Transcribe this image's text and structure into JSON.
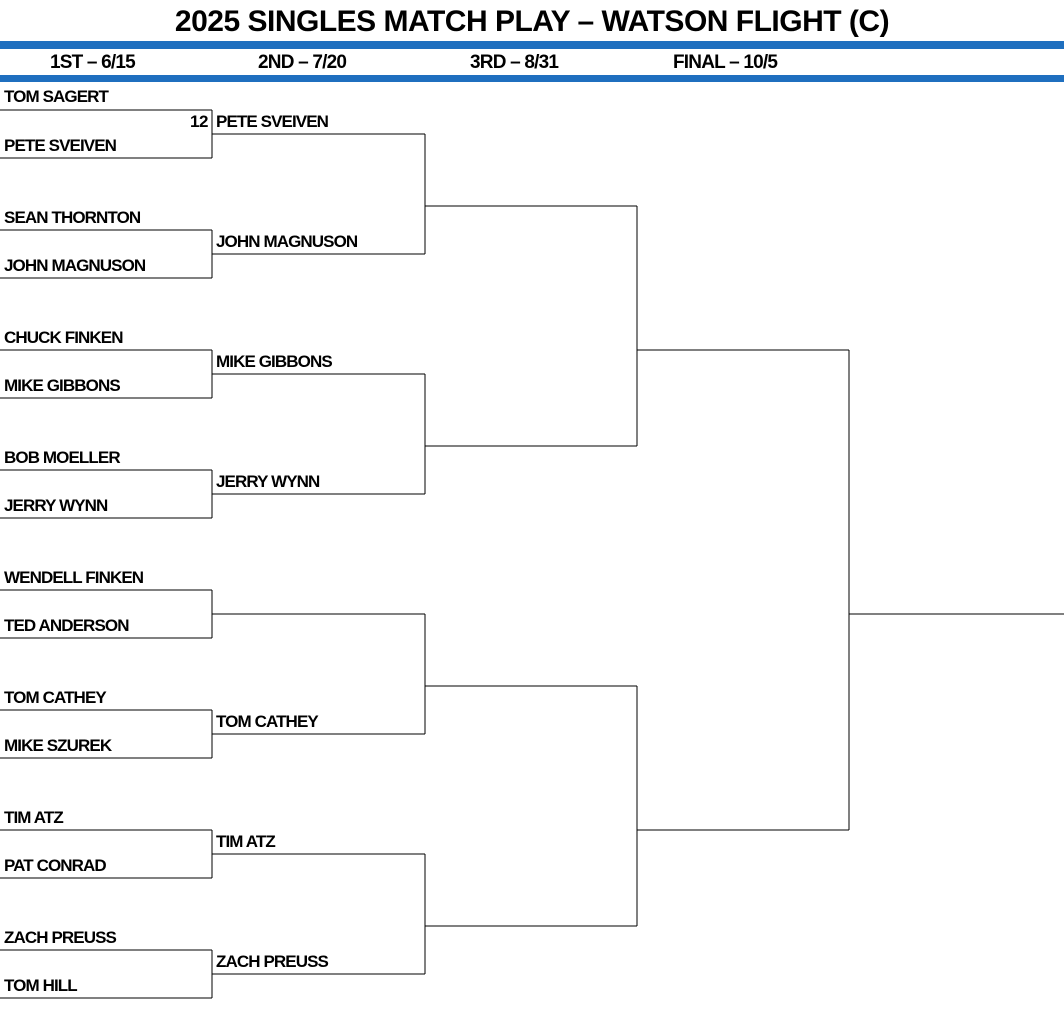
{
  "title": "2025 SINGLES MATCH PLAY – WATSON FLIGHT (C)",
  "colors": {
    "band": "#1f6fbf",
    "line": "#000000"
  },
  "rounds": [
    "1ST – 6/15",
    "2ND – 7/20",
    "3RD – 8/31",
    "FINAL – 10/5"
  ],
  "first_round": [
    "TOM SAGERT",
    "PETE SVEIVEN",
    "SEAN THORNTON",
    "JOHN MAGNUSON",
    "CHUCK FINKEN",
    "MIKE GIBBONS",
    "BOB MOELLER",
    "JERRY WYNN",
    "WENDELL FINKEN",
    "TED ANDERSON",
    "TOM CATHEY",
    "MIKE SZUREK",
    "TIM ATZ",
    "PAT CONRAD",
    "ZACH PREUSS",
    "TOM HILL"
  ],
  "first_round_scores": [
    "12",
    "",
    "",
    "",
    "",
    "",
    "",
    ""
  ],
  "second_round": [
    "PETE SVEIVEN",
    "JOHN MAGNUSON",
    "MIKE GIBBONS",
    "JERRY WYNN",
    "",
    "TOM CATHEY",
    "TIM ATZ",
    "ZACH PREUSS"
  ],
  "third_round": [
    "",
    "",
    "",
    ""
  ],
  "final_round": [
    "",
    ""
  ],
  "champion": ""
}
